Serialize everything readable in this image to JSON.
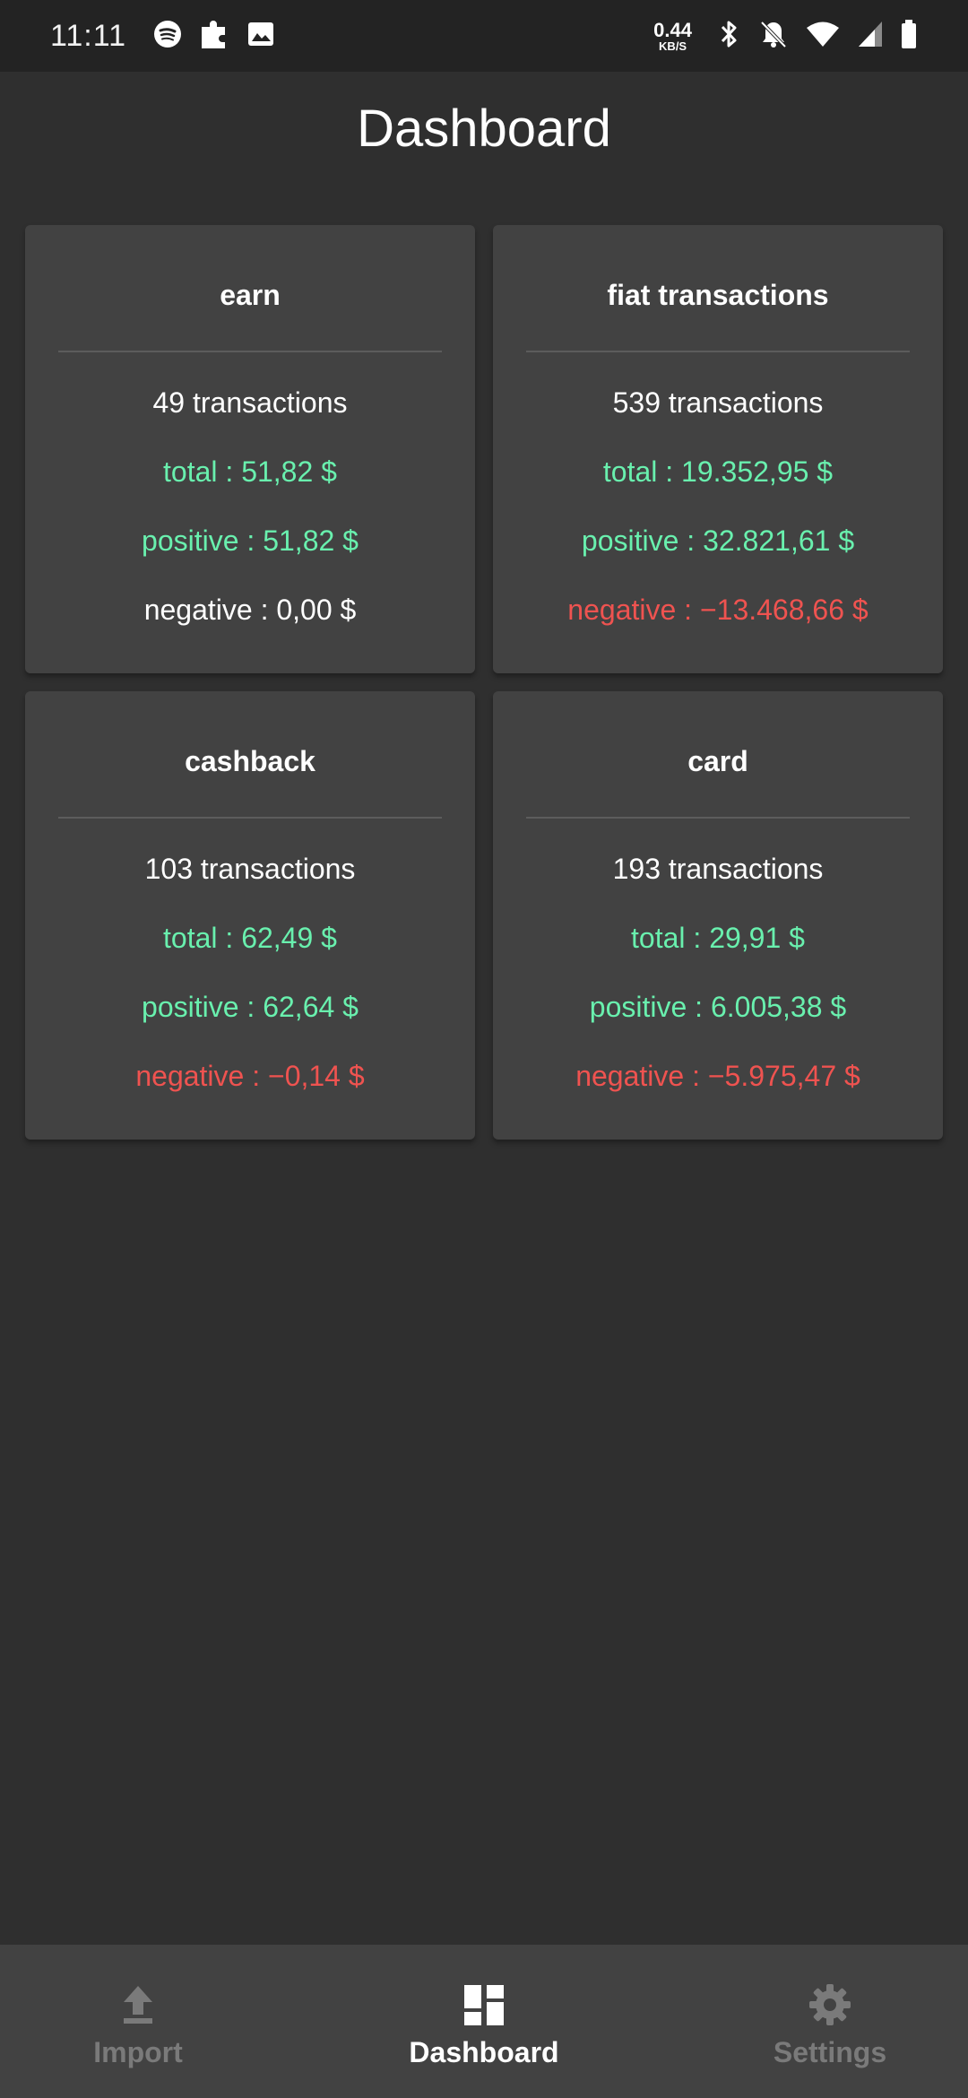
{
  "status_bar": {
    "time": "11:11",
    "net_speed_value": "0.44",
    "net_speed_unit": "KB/S",
    "icons": [
      "spotify-icon",
      "puzzle-icon",
      "image-icon",
      "bluetooth-icon",
      "bell-off-icon",
      "wifi-icon",
      "signal-icon",
      "battery-icon"
    ]
  },
  "header": {
    "title": "Dashboard"
  },
  "cards": [
    {
      "title": "earn",
      "transactions": "49 transactions",
      "total": "total : 51,82 $",
      "positive": "positive : 51,82 $",
      "negative": "negative : 0,00 $",
      "negative_color": "#ffffff"
    },
    {
      "title": "fiat transactions",
      "transactions": "539 transactions",
      "total": "total : 19.352,95 $",
      "positive": "positive : 32.821,61 $",
      "negative": "negative : −13.468,66 $",
      "negative_color": "#ef5350"
    },
    {
      "title": "cashback",
      "transactions": "103 transactions",
      "total": "total : 62,49 $",
      "positive": "positive : 62,64 $",
      "negative": "negative : −0,14 $",
      "negative_color": "#ef5350"
    },
    {
      "title": "card",
      "transactions": "193 transactions",
      "total": "total : 29,91 $",
      "positive": "positive : 6.005,38 $",
      "negative": "negative : −5.975,47 $",
      "negative_color": "#ef5350"
    }
  ],
  "bottom_nav": {
    "items": [
      {
        "label": "Import",
        "icon": "upload-icon",
        "active": false
      },
      {
        "label": "Dashboard",
        "icon": "dashboard-icon",
        "active": true
      },
      {
        "label": "Settings",
        "icon": "gear-icon",
        "active": false
      }
    ]
  },
  "colors": {
    "background": "#2f2f2f",
    "card": "#424242",
    "positive": "#69f0ae",
    "negative": "#ef5350"
  }
}
